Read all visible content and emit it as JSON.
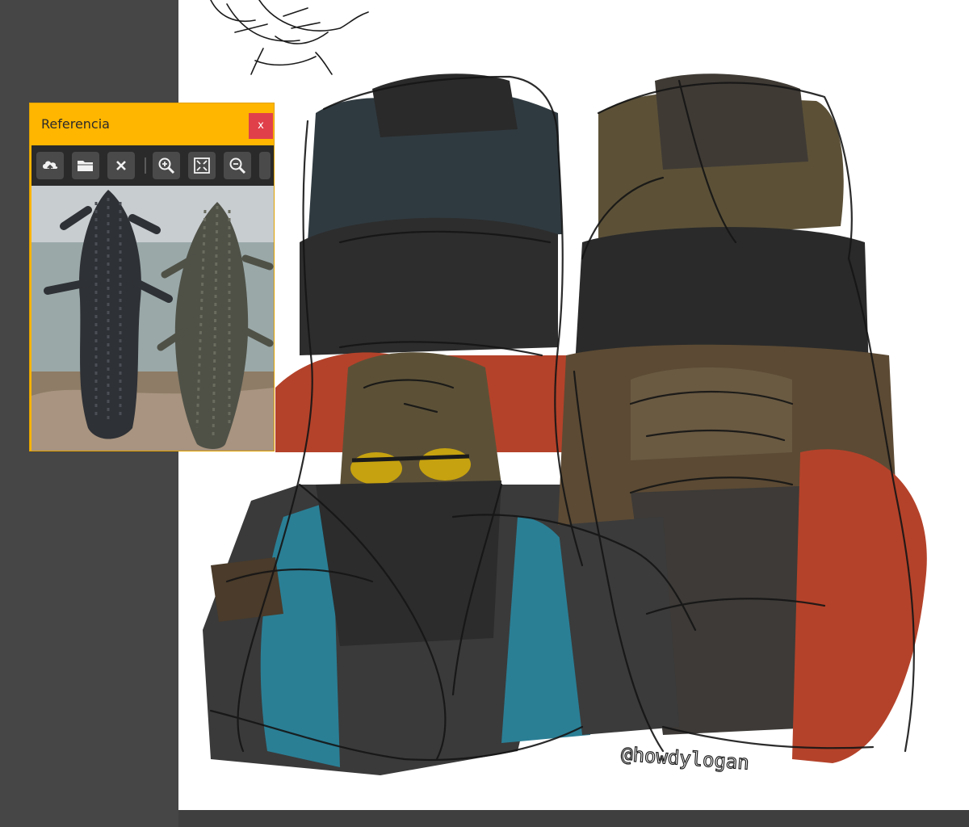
{
  "panel": {
    "title": "Referencia",
    "close_label": "x",
    "toolbar": [
      {
        "name": "import-reference-button",
        "icon": "cloud-upload-icon"
      },
      {
        "name": "open-folder-button",
        "icon": "folder-icon"
      },
      {
        "name": "clear-reference-button",
        "icon": "close-icon"
      },
      {
        "name": "zoom-in-button",
        "icon": "zoom-in-icon"
      },
      {
        "name": "fit-to-view-button",
        "icon": "fit-screen-icon"
      },
      {
        "name": "zoom-out-button",
        "icon": "zoom-out-icon"
      }
    ],
    "accent_color": "#ffb500",
    "close_color": "#e0404a"
  },
  "canvas": {
    "signature": "@howdylogan",
    "background": "#ffffff"
  },
  "colors": {
    "workspace": "#464646",
    "ink": "#1b1b1b",
    "teal": "#2a7f95",
    "rust": "#b4422a",
    "olive": "#5c5137",
    "slate": "#2f3a40",
    "lens_left": "#c6a210",
    "lens_right": "#c97d10"
  }
}
